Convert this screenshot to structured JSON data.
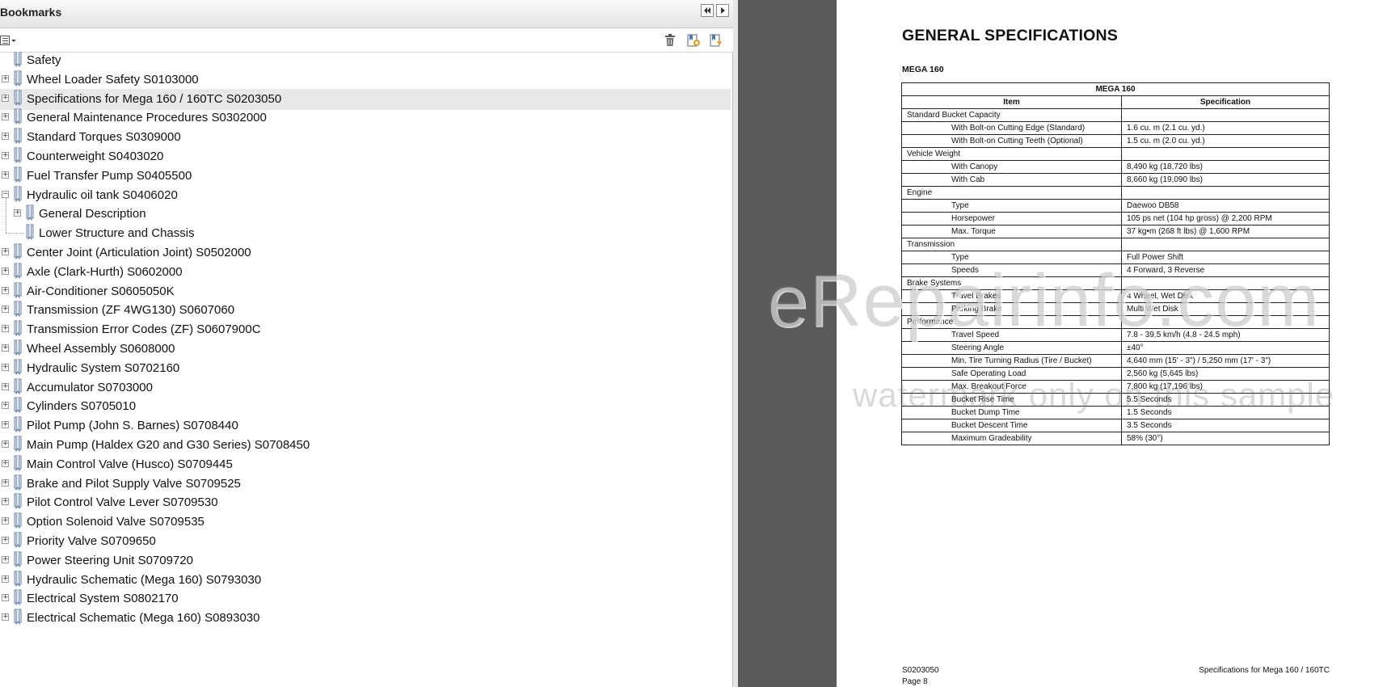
{
  "panel": {
    "title": "Bookmarks",
    "collapse_icon": "double-chevron-left-icon",
    "expand_icon": "triangle-right-icon",
    "options_icon": "list-options-icon",
    "delete_icon": "trash-icon",
    "new_bookmark_icon": "new-bookmark-icon",
    "bookmark_properties_icon": "bookmark-properties-icon"
  },
  "bookmarks": [
    {
      "label": "Safety",
      "level": 0,
      "expander": "none"
    },
    {
      "label": "Wheel Loader Safety S0103000",
      "level": 0,
      "expander": "plus"
    },
    {
      "label": "Specifications for Mega 160 / 160TC S0203050",
      "level": 0,
      "expander": "plus",
      "selected": true
    },
    {
      "label": "General Maintenance Procedures S0302000",
      "level": 0,
      "expander": "plus"
    },
    {
      "label": "Standard Torques S0309000",
      "level": 0,
      "expander": "plus"
    },
    {
      "label": "Counterweight S0403020",
      "level": 0,
      "expander": "plus"
    },
    {
      "label": "Fuel Transfer Pump S0405500",
      "level": 0,
      "expander": "plus"
    },
    {
      "label": "Hydraulic oil tank S0406020",
      "level": 0,
      "expander": "minus"
    },
    {
      "label": "General Description",
      "level": 1,
      "expander": "plus"
    },
    {
      "label": "Lower Structure and Chassis",
      "level": 1,
      "expander": "none"
    },
    {
      "label": "Center Joint (Articulation Joint) S0502000",
      "level": 0,
      "expander": "plus"
    },
    {
      "label": "Axle (Clark-Hurth) S0602000",
      "level": 0,
      "expander": "plus"
    },
    {
      "label": "Air-Conditioner S0605050K",
      "level": 0,
      "expander": "plus"
    },
    {
      "label": "Transmission (ZF 4WG130) S0607060",
      "level": 0,
      "expander": "plus"
    },
    {
      "label": "Transmission Error Codes (ZF) S0607900C",
      "level": 0,
      "expander": "plus"
    },
    {
      "label": "Wheel Assembly S0608000",
      "level": 0,
      "expander": "plus"
    },
    {
      "label": "Hydraulic System S0702160",
      "level": 0,
      "expander": "plus"
    },
    {
      "label": "Accumulator S0703000",
      "level": 0,
      "expander": "plus"
    },
    {
      "label": "Cylinders S0705010",
      "level": 0,
      "expander": "plus"
    },
    {
      "label": "Pilot Pump (John S. Barnes) S0708440",
      "level": 0,
      "expander": "plus"
    },
    {
      "label": "Main Pump (Haldex G20 and G30 Series) S0708450",
      "level": 0,
      "expander": "plus"
    },
    {
      "label": "Main Control Valve (Husco) S0709445",
      "level": 0,
      "expander": "plus"
    },
    {
      "label": "Brake and Pilot Supply Valve S0709525",
      "level": 0,
      "expander": "plus"
    },
    {
      "label": "Pilot Control Valve Lever S0709530",
      "level": 0,
      "expander": "plus"
    },
    {
      "label": "Option Solenoid Valve S0709535",
      "level": 0,
      "expander": "plus"
    },
    {
      "label": "Priority Valve S0709650",
      "level": 0,
      "expander": "plus"
    },
    {
      "label": "Power Steering Unit S0709720",
      "level": 0,
      "expander": "plus"
    },
    {
      "label": "Hydraulic Schematic (Mega 160) S0793030",
      "level": 0,
      "expander": "plus"
    },
    {
      "label": "Electrical System S0802170",
      "level": 0,
      "expander": "plus"
    },
    {
      "label": "Electrical Schematic (Mega 160) S0893030",
      "level": 0,
      "expander": "plus"
    }
  ],
  "document": {
    "title": "GENERAL SPECIFICATIONS",
    "subtitle": "MEGA 160",
    "table_caption": "MEGA 160",
    "col_item": "Item",
    "col_spec": "Specification",
    "rows": [
      {
        "item": "Standard Bucket Capacity",
        "spec": "",
        "group": true
      },
      {
        "item": "With Bolt-on Cutting Edge (Standard)",
        "spec": "1.6 cu. m (2.1 cu. yd.)"
      },
      {
        "item": "With Bolt-on Cutting Teeth (Optional)",
        "spec": "1.5 cu. m (2.0 cu. yd.)"
      },
      {
        "item": "Vehicle Weight",
        "spec": "",
        "group": true
      },
      {
        "item": "With Canopy",
        "spec": "8,490 kg (18,720 lbs)"
      },
      {
        "item": "With Cab",
        "spec": "8,660 kg (19,090 lbs)"
      },
      {
        "item": "Engine",
        "spec": "",
        "group": true
      },
      {
        "item": "Type",
        "spec": "Daewoo DB58"
      },
      {
        "item": "Horsepower",
        "spec": "105 ps net (104 hp gross) @ 2,200 RPM"
      },
      {
        "item": "Max. Torque",
        "spec": "37 kg•m (268 ft lbs) @ 1,600 RPM"
      },
      {
        "item": "Transmission",
        "spec": "",
        "group": true
      },
      {
        "item": "Type",
        "spec": "Full Power Shift"
      },
      {
        "item": "Speeds",
        "spec": "4 Forward, 3 Reverse"
      },
      {
        "item": "Brake Systems",
        "spec": "",
        "group": true
      },
      {
        "item": "Travel Brakes",
        "spec": "4 Wheel, Wet Disk"
      },
      {
        "item": "Parking Brake",
        "spec": "Multi Wet Disk"
      },
      {
        "item": "Performance",
        "spec": "",
        "group": true
      },
      {
        "item": "Travel Speed",
        "spec": "7.8 - 39.5 km/h (4.8 - 24.5 mph)"
      },
      {
        "item": "Steering Angle",
        "spec": "±40°"
      },
      {
        "item": "Min. Tire Turning Radius (Tire / Bucket)",
        "spec": "4,640 mm (15' - 3\") / 5,250 mm (17' - 3\")"
      },
      {
        "item": "Safe Operating Load",
        "spec": "2,560 kg (5,645 lbs)"
      },
      {
        "item": "Max. Breakout Force",
        "spec": "7,800 kg (17,196 lbs)"
      },
      {
        "item": "Bucket Rise Time",
        "spec": "5.5 Seconds"
      },
      {
        "item": "Bucket Dump Time",
        "spec": "1.5 Seconds"
      },
      {
        "item": "Bucket Descent Time",
        "spec": "3.5 Seconds"
      },
      {
        "item": "Maximum Gradeability",
        "spec": "58% (30°)"
      }
    ],
    "footer_code": "S0203050",
    "footer_page": "Page 8",
    "footer_title": "Specifications for Mega 160 / 160TC"
  },
  "watermark": {
    "main": "eRepairinfo.com",
    "sub": "watermark only on this sample"
  }
}
